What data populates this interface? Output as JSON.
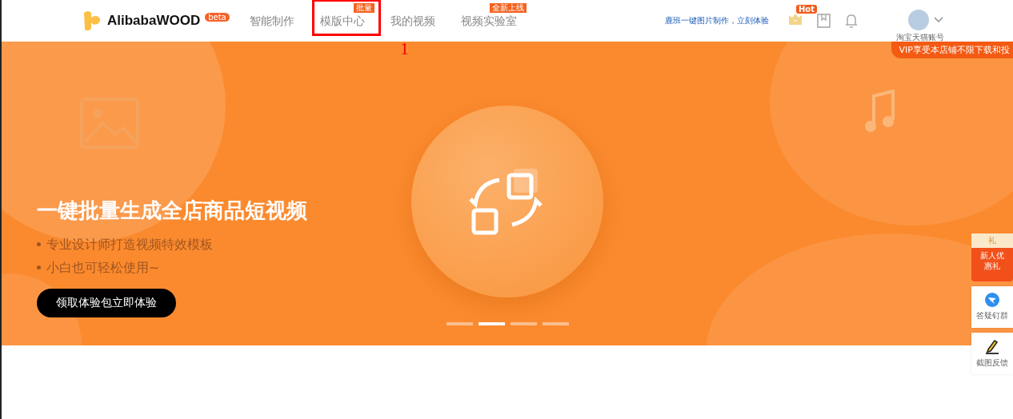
{
  "header": {
    "logo": {
      "name": "AlibabaWOOD",
      "badge": "beta"
    },
    "nav": [
      {
        "label": "智能制作",
        "selected": false
      },
      {
        "label": "模版中心",
        "selected": false,
        "badge": "批量"
      },
      {
        "label": "我的视频",
        "selected": false
      },
      {
        "label": "视频实验室",
        "selected": false,
        "badge": "全新上线"
      }
    ],
    "promo_link": "鹿班一键图片制作，立刻体验",
    "hot_badge": "Hot",
    "account": "淘宝天猫账号"
  },
  "annotation": {
    "label": "1"
  },
  "banner": {
    "ribbon": "VIP享受本店铺不限下载和投",
    "title": "一键批量生成全店商品短视频",
    "bullets": [
      "专业设计师打造视频特效模板",
      "小白也可轻松使用~"
    ],
    "button": "领取体验包立即体验",
    "dots": [
      {
        "selected": false
      },
      {
        "selected": true
      },
      {
        "selected": false
      },
      {
        "selected": false
      }
    ]
  },
  "side_widgets": [
    {
      "kind": "gift",
      "icon_text": "礼",
      "label": "新人优惠礼"
    },
    {
      "kind": "service",
      "label": "答疑钉群"
    },
    {
      "kind": "feedback",
      "label": "截图反馈"
    }
  ]
}
